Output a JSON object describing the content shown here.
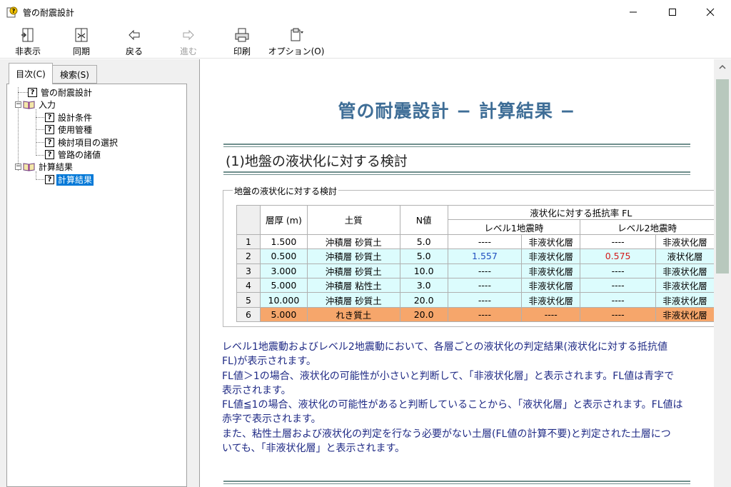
{
  "window": {
    "title": "管の耐震設計",
    "controls": {
      "minimize": "minimize-icon",
      "maximize": "maximize-icon",
      "close": "close-icon"
    }
  },
  "toolbar": {
    "buttons": [
      {
        "label": "非表示",
        "icon": "hide-pane-icon",
        "enabled": true
      },
      {
        "label": "同期",
        "icon": "sync-icon",
        "enabled": true
      },
      {
        "label": "戻る",
        "icon": "back-arrow-icon",
        "enabled": true
      },
      {
        "label": "進む",
        "icon": "forward-arrow-icon",
        "enabled": false
      },
      {
        "label": "印刷",
        "icon": "print-icon",
        "enabled": true
      },
      {
        "label": "オプション(O)",
        "icon": "options-icon",
        "enabled": true
      }
    ]
  },
  "sidebar": {
    "tabs": [
      {
        "label": "目次(C)",
        "active": true
      },
      {
        "label": "検索(S)",
        "active": false
      }
    ],
    "tree": [
      {
        "label": "管の耐震設計",
        "type": "topic",
        "level": 0
      },
      {
        "label": "入力",
        "type": "book-open",
        "level": 0
      },
      {
        "label": "設計条件",
        "type": "topic",
        "level": 1
      },
      {
        "label": "使用管種",
        "type": "topic",
        "level": 1
      },
      {
        "label": "検討項目の選択",
        "type": "topic",
        "level": 1
      },
      {
        "label": "管路の諸値",
        "type": "topic",
        "level": 1
      },
      {
        "label": "計算結果",
        "type": "book-open",
        "level": 0
      },
      {
        "label": "計算結果",
        "type": "topic",
        "level": 1,
        "selected": true
      }
    ]
  },
  "content": {
    "title": "管の耐震設計 − 計算結果 −",
    "section_heading": "(1)地盤の液状化に対する検討",
    "group_label": "地盤の液状化に対する検討",
    "table": {
      "headers": {
        "thickness": "層厚 (m)",
        "soil": "土質",
        "n_value": "N値",
        "fl_group": "液状化に対する抵抗率 FL",
        "level1": "レベル1地震時",
        "level2": "レベル2地震時"
      },
      "rows": [
        {
          "no": "1",
          "thickness": "1.500",
          "soil": "沖積層 砂質土",
          "n": "5.0",
          "l1_fl": "----",
          "l1_judge": "非液状化層",
          "l2_fl": "----",
          "l2_judge": "非液状化層",
          "style": "white"
        },
        {
          "no": "2",
          "thickness": "0.500",
          "soil": "沖積層 砂質土",
          "n": "5.0",
          "l1_fl": "1.557",
          "l1_judge": "非液状化層",
          "l2_fl": "0.575",
          "l2_judge": "液状化層",
          "style": "cyan",
          "l1_color": "#1f4fbf",
          "l2_color": "#d21a1a"
        },
        {
          "no": "3",
          "thickness": "3.000",
          "soil": "沖積層 砂質土",
          "n": "10.0",
          "l1_fl": "----",
          "l1_judge": "非液状化層",
          "l2_fl": "----",
          "l2_judge": "非液状化層",
          "style": "cyan"
        },
        {
          "no": "4",
          "thickness": "5.000",
          "soil": "沖積層 粘性土",
          "n": "3.0",
          "l1_fl": "----",
          "l1_judge": "非液状化層",
          "l2_fl": "----",
          "l2_judge": "非液状化層",
          "style": "cyan"
        },
        {
          "no": "5",
          "thickness": "10.000",
          "soil": "沖積層 砂質土",
          "n": "20.0",
          "l1_fl": "----",
          "l1_judge": "非液状化層",
          "l2_fl": "----",
          "l2_judge": "非液状化層",
          "style": "cyan"
        },
        {
          "no": "6",
          "thickness": "5.000",
          "soil": "れき質土",
          "n": "20.0",
          "l1_fl": "----",
          "l1_judge": "----",
          "l2_fl": "----",
          "l2_judge": "非液状化層",
          "style": "orange"
        }
      ]
    },
    "paragraph_lines": [
      "レベル1地震動およびレベル2地震動において、各層ごとの液状化の判定結果(液状化に対する抵抗値",
      "FL)が表示されます。",
      "FL値＞1の場合、液状化の可能性が小さいと判断して、「非液状化層」と表示されます。FL値は青字で",
      "表示されます。",
      "FL値≦1の場合、液状化の可能性があると判断していることから、「液状化層」と表示されます。FL値は",
      "赤字で表示されます。",
      "また、粘性土層および液状化の判定を行なう必要がない土層(FL値の計算不要)と判定された土層につ",
      "いても、「非液状化層」と表示されます。"
    ]
  },
  "colors": {
    "title_blue": "#3e6d96",
    "text_navy": "#1f2a85",
    "row_cyan": "#dcfcfd",
    "row_orange": "#f6a66b",
    "selection": "#0078d7"
  }
}
